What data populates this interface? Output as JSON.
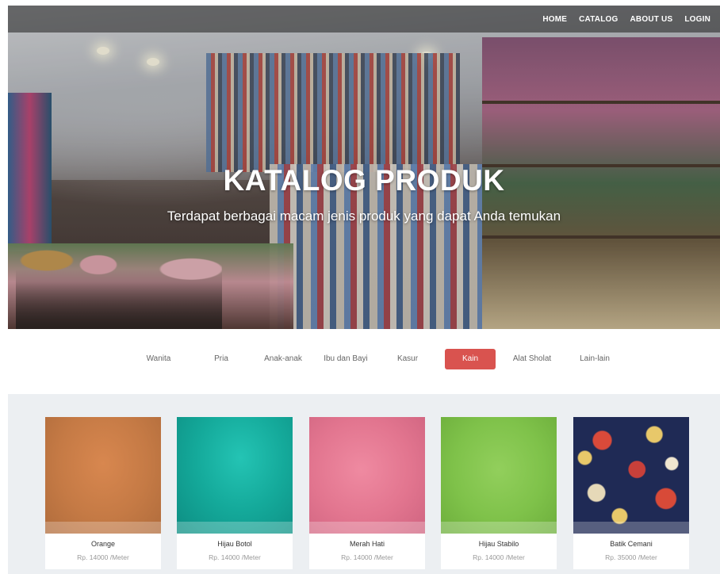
{
  "nav": {
    "home": "HOME",
    "catalog": "CATALOG",
    "about": "ABOUT US",
    "login": "LOGIN"
  },
  "hero": {
    "title": "KATALOG PRODUK",
    "subtitle": "Terdapat berbagai macam jenis produk yang dapat Anda temukan"
  },
  "categories": [
    {
      "label": "Wanita"
    },
    {
      "label": "Pria"
    },
    {
      "label": "Anak-anak"
    },
    {
      "label": "Ibu dan Bayi"
    },
    {
      "label": "Kasur"
    },
    {
      "label": "Kain"
    },
    {
      "label": "Alat Sholat"
    },
    {
      "label": "Lain-lain"
    }
  ],
  "active_category": "Kain",
  "colors": {
    "accent": "#d9534f",
    "section_bg": "#eceff2"
  },
  "products": [
    {
      "name": "Orange",
      "price": "Rp. 14000 /Meter",
      "swatch": "#c57a45"
    },
    {
      "name": "Hijau Botol",
      "price": "Rp. 14000 /Meter",
      "swatch": "#14a99a"
    },
    {
      "name": "Merah Hati",
      "price": "Rp. 14000 /Meter",
      "swatch": "#e2758f"
    },
    {
      "name": "Hijau Stabilo",
      "price": "Rp. 14000 /Meter",
      "swatch": "#7fc24a"
    },
    {
      "name": "Batik Cemani",
      "price": "Rp. 35000 /Meter",
      "swatch": "#1f2a55"
    }
  ]
}
